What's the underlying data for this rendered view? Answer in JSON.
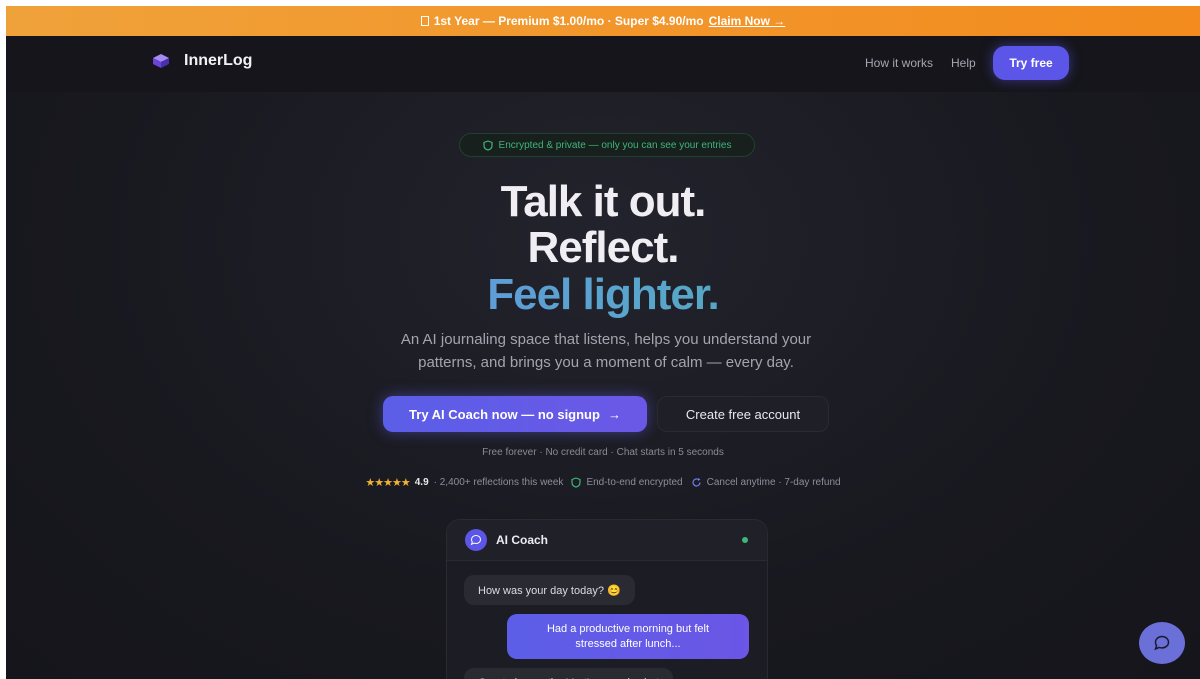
{
  "promo": {
    "icon": "gift-icon",
    "text": "1st Year — Premium $1.00/mo · Super $4.90/mo",
    "claim_label": "Claim Now →"
  },
  "nav": {
    "brand": "InnerLog",
    "links": [
      {
        "label": "How it works"
      },
      {
        "label": "Help"
      }
    ],
    "cta_label": "Try free"
  },
  "hero": {
    "badge": "Encrypted & private — only you can see your entries",
    "headline_1": "Talk it out.",
    "headline_2": "Reflect.",
    "headline_3": "Feel lighter.",
    "subtitle": "An AI journaling space that listens, helps you understand your patterns, and brings you a moment of calm — every day.",
    "primary_cta": "Try AI Coach now — no signup",
    "secondary_cta": "Create free account",
    "fineprint": "Free forever · No credit card · Chat starts in 5 seconds",
    "trust": {
      "stars": "★★★★★",
      "rating": "4.9",
      "reflections": "· 2,400+ reflections this week",
      "encrypted": "End-to-end encrypted",
      "cancel": "Cancel anytime · 7-day refund"
    }
  },
  "chat": {
    "coach_name": "AI Coach",
    "messages": [
      {
        "from": "coach",
        "text": "How was your day today? 😊"
      },
      {
        "from": "user",
        "text": "Had a productive morning but felt stressed after lunch..."
      },
      {
        "from": "coach",
        "text": "Great observation! Let's unpack what"
      }
    ]
  },
  "colors": {
    "accent": "#5b56e8",
    "promo": "#f38b1e",
    "success": "#3fb57a",
    "background": "#16161e"
  }
}
